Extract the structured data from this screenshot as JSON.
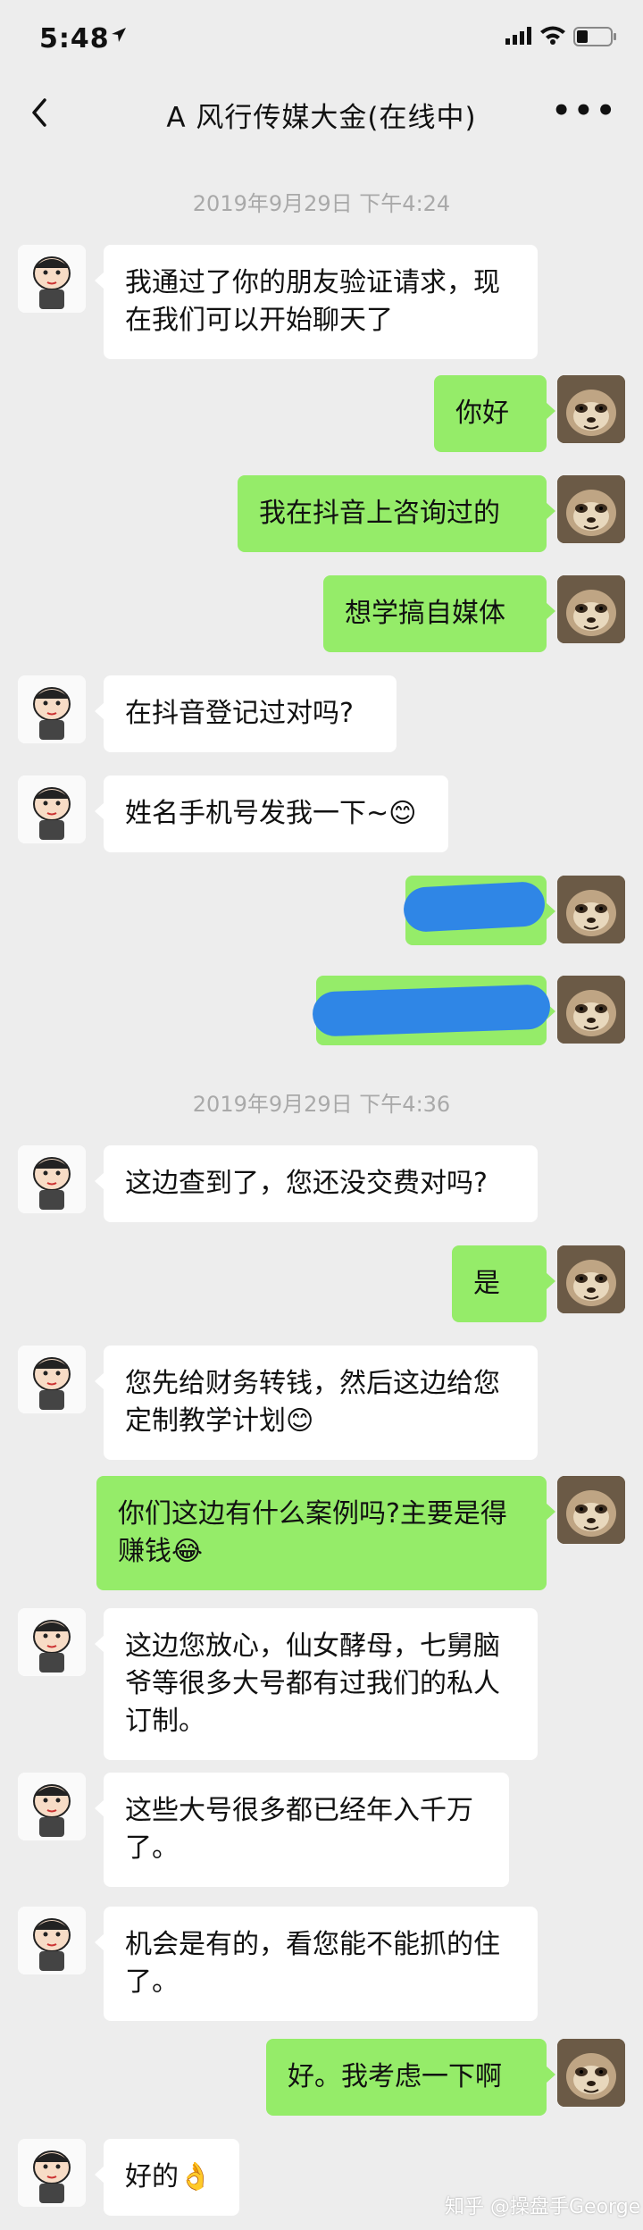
{
  "status_bar": {
    "time": "5:48"
  },
  "header": {
    "title": "A 风行传媒大金(在线中)"
  },
  "timestamps": [
    "2019年9月29日 下午4:24",
    "2019年9月29日 下午4:36"
  ],
  "messages": [
    {
      "from": "contact",
      "text": "我通过了你的朋友验证请求，现在我们可以开始聊天了"
    },
    {
      "from": "me",
      "text": "你好"
    },
    {
      "from": "me",
      "text": "我在抖音上咨询过的"
    },
    {
      "from": "me",
      "text": "想学搞自媒体"
    },
    {
      "from": "contact",
      "text": "在抖音登记过对吗?"
    },
    {
      "from": "contact",
      "text": "姓名手机号发我一下~😊"
    },
    {
      "from": "me",
      "text": "",
      "redacted": true
    },
    {
      "from": "me",
      "text": "",
      "redacted": true
    },
    {
      "from": "contact",
      "text": "这边查到了，您还没交费对吗?"
    },
    {
      "from": "me",
      "text": "是"
    },
    {
      "from": "contact",
      "text": "您先给财务转钱，然后这边给您定制教学计划😊"
    },
    {
      "from": "me",
      "text": "你们这边有什么案例吗?主要是得赚钱😂"
    },
    {
      "from": "contact",
      "text": "这边您放心，仙女酵母，七舅脑爷等很多大号都有过我们的私人订制。"
    },
    {
      "from": "contact",
      "text": "这些大号很多都已经年入千万了。"
    },
    {
      "from": "contact",
      "text": "机会是有的，看您能不能抓的住了。"
    },
    {
      "from": "me",
      "text": "好。我考虑一下啊"
    },
    {
      "from": "contact",
      "text": "好的👌"
    }
  ],
  "watermark": "知乎 @操盘手George",
  "colors": {
    "background": "#ededed",
    "my_bubble": "#95ec69",
    "their_bubble": "#ffffff",
    "redaction": "#2f86e6"
  }
}
